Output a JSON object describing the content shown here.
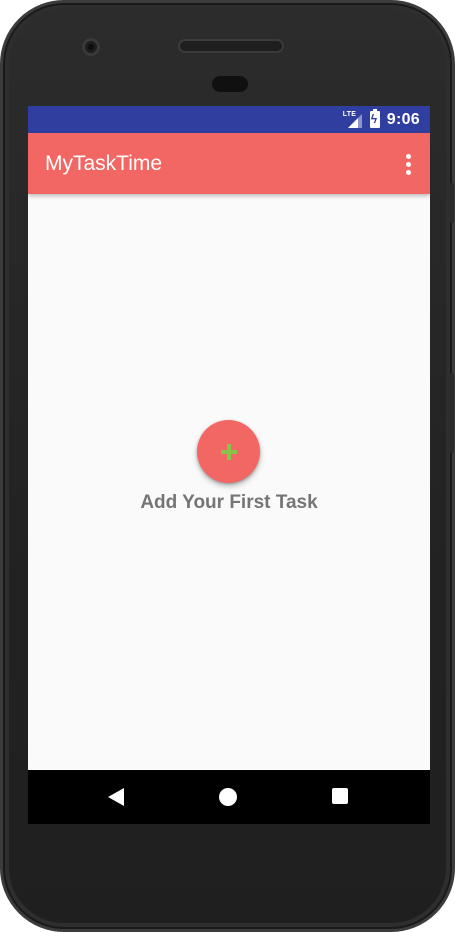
{
  "status_bar": {
    "network_label": "LTE",
    "time": "9:06",
    "icons": [
      "signal-icon",
      "battery-charging-icon"
    ]
  },
  "app_bar": {
    "title": "MyTaskTime",
    "menu_icon": "more-vert-icon"
  },
  "main": {
    "fab_icon": "add-icon",
    "empty_state_label": "Add Your First Task"
  },
  "navigation_bar": {
    "icons": [
      "back-icon",
      "home-icon",
      "recents-icon"
    ]
  },
  "colors": {
    "status_bar": "#303f9f",
    "primary": "#f26763",
    "fab_plus": "#8bc34a",
    "background": "#fafafa",
    "label_text": "#757575"
  }
}
